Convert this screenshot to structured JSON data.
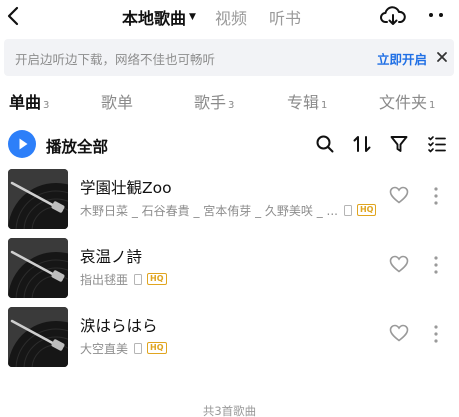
{
  "header": {
    "tabs": [
      "本地歌曲",
      "视频",
      "听书"
    ],
    "active_tab": "本地歌曲"
  },
  "banner": {
    "text": "开启边听边下载，网络不佳也可畅听",
    "action": "立即开启"
  },
  "categories": [
    {
      "label": "单曲",
      "count": "3"
    },
    {
      "label": "歌单",
      "count": ""
    },
    {
      "label": "歌手",
      "count": "3"
    },
    {
      "label": "专辑",
      "count": "1"
    },
    {
      "label": "文件夹",
      "count": "1"
    }
  ],
  "play_all": {
    "label": "播放全部"
  },
  "songs": [
    {
      "title": "学園壮観Zoo",
      "artist": "木野日菜 _ 石谷春貴 _ 宮本侑芽 _ 久野美咲 _ ...",
      "quality": "HQ"
    },
    {
      "title": "哀温ノ詩",
      "artist": "指出毬亜",
      "quality": "HQ"
    },
    {
      "title": "涙はらはら",
      "artist": "大空直美",
      "quality": "HQ"
    }
  ],
  "footer": {
    "text": "共3首歌曲"
  },
  "colors": {
    "accent": "#2d7ff9",
    "link": "#1f6fe5",
    "hq": "#e0a520"
  }
}
